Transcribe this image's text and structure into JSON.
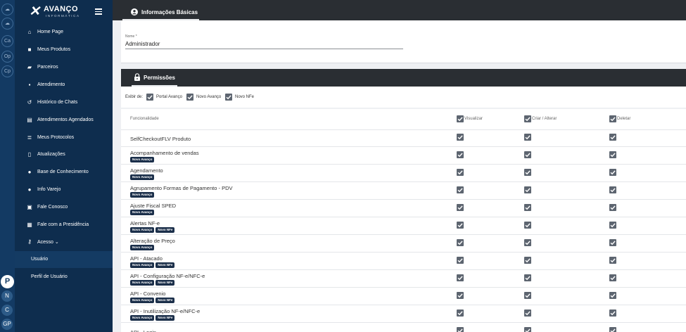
{
  "brand": {
    "name": "AVANÇO",
    "subtitle": "INFORMÁTICA"
  },
  "rail": {
    "top_icons": [
      "cloud-icon",
      "Ca",
      "Op",
      "Cp",
      "cloud-icon"
    ],
    "bottom": [
      "P",
      "N",
      "C",
      "GP"
    ]
  },
  "sidebar": {
    "items": [
      {
        "label": "Home Page",
        "icon": "home-icon"
      },
      {
        "label": "Meus Produtos",
        "icon": "box-icon"
      },
      {
        "label": "Parceiros",
        "icon": "handshake-icon"
      },
      {
        "label": "Atendimento",
        "icon": "chat-icon"
      },
      {
        "label": "Histórico de Chats",
        "icon": "history-icon"
      },
      {
        "label": "Atendimentos Agendados",
        "icon": "calendar-icon"
      },
      {
        "label": "Meus Protocolos",
        "icon": "list-icon"
      },
      {
        "label": "Atualizações",
        "icon": "document-icon"
      },
      {
        "label": "Base de Conhecimento",
        "icon": "bulb-icon"
      },
      {
        "label": "Info Varejo",
        "icon": "info-icon"
      },
      {
        "label": "Fale Conosco",
        "icon": "contact-icon"
      },
      {
        "label": "Fale com a Presidência",
        "icon": "briefcase-icon"
      },
      {
        "label": "Acesso",
        "icon": "key-icon"
      }
    ],
    "sub_items": [
      {
        "label": "Usuário",
        "active": true
      },
      {
        "label": "Perfil de Usuário",
        "active": false
      }
    ]
  },
  "header": {
    "tab_label": "Informações Básicas"
  },
  "form": {
    "name_label": "Nome *",
    "name_value": "Administrador"
  },
  "permissions": {
    "tab_label": "Permissões",
    "filter_label": "Exibir de:",
    "filters": [
      "Portal Avanço",
      "Novo Avanço",
      "Novo NFe"
    ],
    "columns": {
      "feature": "Funcionalidade",
      "view": "Visualizar",
      "edit": "Criar / Alterar",
      "delete": "Deletar"
    },
    "rows": [
      {
        "name": "SelfCheckoutFLV Produto",
        "badges": []
      },
      {
        "name": "Acompanhamento de vendas",
        "badges": [
          "Novo Avanço"
        ]
      },
      {
        "name": "Agendamento",
        "badges": [
          "Novo Avanço"
        ]
      },
      {
        "name": "Agrupamento Formas de Pagamento - PDV",
        "badges": [
          "Novo Avanço"
        ]
      },
      {
        "name": "Ajuste Fiscal SPED",
        "badges": [
          "Novo Avanço"
        ]
      },
      {
        "name": "Alertas NF-e",
        "badges": [
          "Novo Avanço",
          "Novo NFe"
        ]
      },
      {
        "name": "Alteração de Preço",
        "badges": [
          "Novo Avanço"
        ]
      },
      {
        "name": "API - Atacado",
        "badges": [
          "Novo Avanço",
          "Novo NFe"
        ]
      },
      {
        "name": "API - Configuração NF-e/NFC-e",
        "badges": [
          "Novo Avanço",
          "Novo NFe"
        ]
      },
      {
        "name": "API - Convenio",
        "badges": [
          "Novo Avanço",
          "Novo NFe"
        ]
      },
      {
        "name": "API - Inutilização NF-e/NFC-e",
        "badges": [
          "Novo Avanço",
          "Novo NFe"
        ]
      },
      {
        "name": "API - Login",
        "badges": []
      }
    ]
  },
  "colors": {
    "sidebar": "#0e2d4e",
    "rail": "#133a63",
    "topbar": "#2a2e33",
    "checkbox": "#5d6570",
    "badge": "#1b2f4a"
  }
}
